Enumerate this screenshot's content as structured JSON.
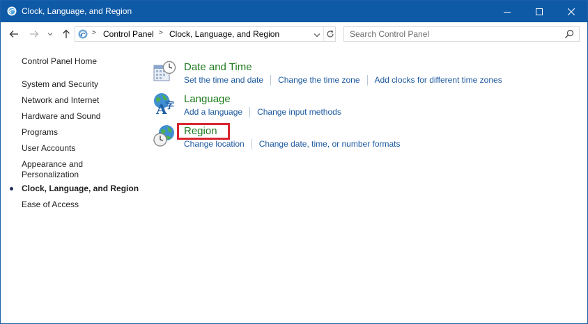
{
  "window": {
    "title": "Clock, Language, and Region",
    "minimize_icon": "minimize-icon",
    "maximize_icon": "maximize-icon",
    "close_icon": "close-icon"
  },
  "navigation": {
    "back_icon": "back-arrow-icon",
    "forward_icon": "forward-arrow-icon",
    "recent_icon": "chevron-down-icon",
    "up_icon": "up-arrow-icon"
  },
  "address": {
    "separator": ">",
    "crumbs": [
      "Control Panel",
      "Clock, Language, and Region"
    ]
  },
  "search": {
    "placeholder": "Search Control Panel",
    "value": ""
  },
  "sidebar": {
    "items": [
      {
        "label": "Control Panel Home"
      },
      {
        "label": "System and Security"
      },
      {
        "label": "Network and Internet"
      },
      {
        "label": "Hardware and Sound"
      },
      {
        "label": "Programs"
      },
      {
        "label": "User Accounts"
      },
      {
        "label": "Appearance and Personalization",
        "lines": [
          "Appearance and",
          "Personalization"
        ]
      },
      {
        "label": "Clock, Language, and Region",
        "current": true
      },
      {
        "label": "Ease of Access"
      }
    ]
  },
  "categories": [
    {
      "title": "Date and Time",
      "icon": "calendar-clock-icon",
      "tasks": [
        "Set the time and date",
        "Change the time zone",
        "Add clocks for different time zones"
      ]
    },
    {
      "title": "Language",
      "icon": "language-globe-icon",
      "tasks": [
        "Add a language",
        "Change input methods"
      ]
    },
    {
      "title": "Region",
      "icon": "region-globe-clock-icon",
      "highlighted": true,
      "tasks": [
        "Change location",
        "Change date, time, or number formats"
      ]
    }
  ],
  "colors": {
    "titlebar": "#0f5aa6",
    "category_title": "#1e7b1e",
    "task_link": "#1e5aa0",
    "highlight": "#d8262f"
  }
}
